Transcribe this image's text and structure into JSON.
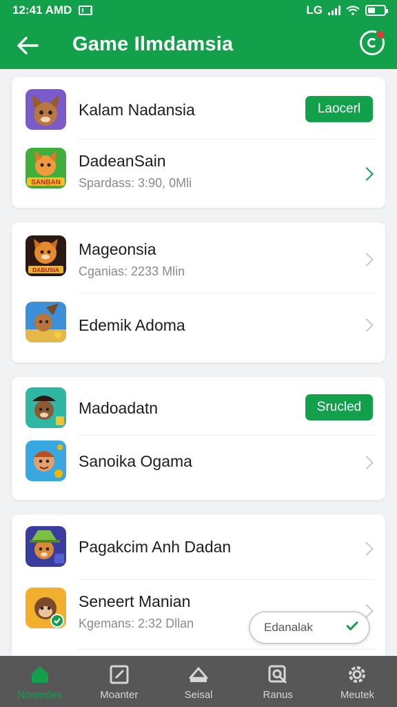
{
  "status_bar": {
    "time": "12:41 AMD",
    "network_label": "LG"
  },
  "app_bar": {
    "title": "Game Ilmdamsia"
  },
  "colors": {
    "primary": "#12a04a",
    "nav_background": "#575757",
    "badge": "#e53935"
  },
  "cards": [
    {
      "items": [
        {
          "title": "Kalam Nadansia",
          "subtitle": "",
          "action": "Laocerl",
          "icon": "fox-character-icon"
        },
        {
          "title": "DadeanSain",
          "subtitle": "Spardass: 3:90, 0Mli",
          "icon": "cat-character-icon",
          "chevron_accent": true
        }
      ]
    },
    {
      "items": [
        {
          "title": "Mageonsia",
          "subtitle": "Cganias: 2233 Mlin",
          "icon": "lion-character-icon"
        },
        {
          "title": "Edemik Adoma",
          "subtitle": "",
          "icon": "adventurer-character-icon"
        }
      ]
    },
    {
      "items": [
        {
          "title": "Madoadatn",
          "subtitle": "",
          "action": "Srucled",
          "icon": "explorer-character-icon"
        },
        {
          "title": "Sanoika Ogama",
          "subtitle": "",
          "icon": "kid-character-icon"
        }
      ]
    },
    {
      "items": [
        {
          "title": "Pagakcim Anh Dadan",
          "subtitle": "",
          "icon": "hat-fox-character-icon"
        },
        {
          "title": "Seneert Manian",
          "subtitle": "Kgemans: 2:32 Dllan",
          "icon": "monkey-character-icon"
        }
      ]
    }
  ],
  "floating_pill": {
    "label": "Edanalak"
  },
  "bottom_nav": [
    {
      "label": "Nonerdes",
      "icon": "home-icon",
      "active": true
    },
    {
      "label": "Moanter",
      "icon": "edit-icon",
      "active": false
    },
    {
      "label": "Seisal",
      "icon": "cabin-icon",
      "active": false
    },
    {
      "label": "Ranus",
      "icon": "search-box-icon",
      "active": false
    },
    {
      "label": "Meutek",
      "icon": "gear-circle-icon",
      "active": false
    }
  ]
}
